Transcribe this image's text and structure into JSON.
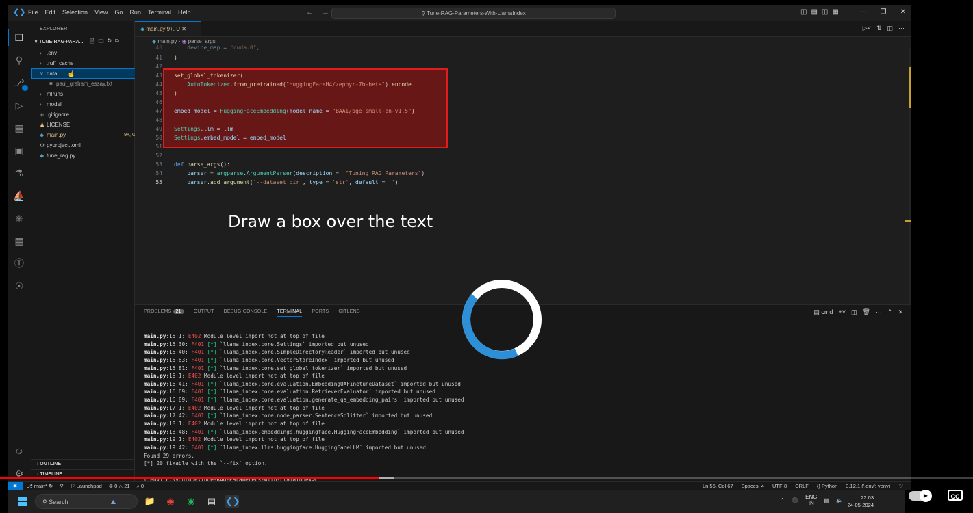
{
  "titlebar": {
    "menu": [
      "File",
      "Edit",
      "Selection",
      "View",
      "Go",
      "Run",
      "Terminal",
      "Help"
    ],
    "search": "Tune-RAG-Parameters-With-LlamaIndex"
  },
  "explorer": {
    "header": "EXPLORER",
    "folder": "TUNE-RAG-PARA...",
    "items": [
      {
        "label": ".env",
        "status": ""
      },
      {
        "label": ".ruff_cache",
        "status": ""
      },
      {
        "label": "data",
        "status": ""
      },
      {
        "label": "paul_graham_essay.txt",
        "status": ""
      },
      {
        "label": "mlruns",
        "status": ""
      },
      {
        "label": "model",
        "status": ""
      },
      {
        "label": ".gitignore",
        "status": ""
      },
      {
        "label": "LICENSE",
        "status": ""
      },
      {
        "label": "main.py",
        "status": "9+, U"
      },
      {
        "label": "pyproject.toml",
        "status": ""
      },
      {
        "label": "tune_rag.py",
        "status": ""
      }
    ],
    "outline": "OUTLINE",
    "timeline": "TIMELINE"
  },
  "tab": {
    "name": "main.py",
    "status": "9+, U"
  },
  "breadcrumb": {
    "file": "main.py",
    "symbol": "parse_args"
  },
  "editor": {
    "line41": "41",
    "line42": "42",
    "line43": "43",
    "line44": "44",
    "line45": "45",
    "line46": "46",
    "line47": "47",
    "line48": "48",
    "line49": "49",
    "line50": "50",
    "line51": "51",
    "line52": "52",
    "line53": "53",
    "line54": "54",
    "line55": "55"
  },
  "overlay": {
    "text": "Draw a box over the text"
  },
  "panel": {
    "tabs": [
      "PROBLEMS",
      "OUTPUT",
      "DEBUG CONSOLE",
      "TERMINAL",
      "PORTS",
      "GITLENS"
    ],
    "problem_count": "21",
    "shell": "cmd",
    "terminal_lines": [
      {
        "file": "main.py",
        "pos": ":15:1: ",
        "code": "E402",
        "fix": "",
        "msg": " Module level import not at top of file"
      },
      {
        "file": "main.py",
        "pos": ":15:30: ",
        "code": "F401",
        "fix": " [*]",
        "msg": " `llama_index.core.Settings` imported but unused"
      },
      {
        "file": "main.py",
        "pos": ":15:40: ",
        "code": "F401",
        "fix": " [*]",
        "msg": " `llama_index.core.SimpleDirectoryReader` imported but unused"
      },
      {
        "file": "main.py",
        "pos": ":15:63: ",
        "code": "F401",
        "fix": " [*]",
        "msg": " `llama_index.core.VectorStoreIndex` imported but unused"
      },
      {
        "file": "main.py",
        "pos": ":15:81: ",
        "code": "F401",
        "fix": " [*]",
        "msg": " `llama_index.core.set_global_tokenizer` imported but unused"
      },
      {
        "file": "main.py",
        "pos": ":16:1: ",
        "code": "E402",
        "fix": "",
        "msg": " Module level import not at top of file"
      },
      {
        "file": "main.py",
        "pos": ":16:41: ",
        "code": "F401",
        "fix": " [*]",
        "msg": " `llama_index.core.evaluation.EmbeddingQAFinetuneDataset` imported but unused"
      },
      {
        "file": "main.py",
        "pos": ":16:69: ",
        "code": "F401",
        "fix": " [*]",
        "msg": " `llama_index.core.evaluation.RetrieverEvaluator` imported but unused"
      },
      {
        "file": "main.py",
        "pos": ":16:89: ",
        "code": "F401",
        "fix": " [*]",
        "msg": " `llama_index.core.evaluation.generate_qa_embedding_pairs` imported but unused"
      },
      {
        "file": "main.py",
        "pos": ":17:1: ",
        "code": "E402",
        "fix": "",
        "msg": " Module level import not at top of file"
      },
      {
        "file": "main.py",
        "pos": ":17:42: ",
        "code": "F401",
        "fix": " [*]",
        "msg": " `llama_index.core.node_parser.SentenceSplitter` imported but unused"
      },
      {
        "file": "main.py",
        "pos": ":18:1: ",
        "code": "E402",
        "fix": "",
        "msg": " Module level import not at top of file"
      },
      {
        "file": "main.py",
        "pos": ":18:48: ",
        "code": "F401",
        "fix": " [*]",
        "msg": " `llama_index.embeddings.huggingface.HuggingFaceEmbedding` imported but unused"
      },
      {
        "file": "main.py",
        "pos": ":19:1: ",
        "code": "E402",
        "fix": "",
        "msg": " Module level import not at top of file"
      },
      {
        "file": "main.py",
        "pos": ":19:42: ",
        "code": "F401",
        "fix": " [*]",
        "msg": " `llama_index.llms.huggingface.HuggingFaceLLM` imported but unused"
      }
    ],
    "summary1": "Found 29 errors.",
    "summary2": "[*] 20 fixable with the `--fix` option.",
    "prompt": "(.env) E:\\youtube\\Tune-RAG-Parameters-With-LlamaIndex>"
  },
  "statusbar": {
    "branch": "main*",
    "launchpad": "Launchpad",
    "errors": "0",
    "warnings": "21",
    "ports": "0",
    "position": "Ln 55, Col 67",
    "spaces": "Spaces: 4",
    "encoding": "UTF-8",
    "eol": "CRLF",
    "language": "Python",
    "interpreter": "3.12.1 ('.env': venv)"
  },
  "taskbar": {
    "search": "Search",
    "lang": "ENG",
    "region": "IN",
    "time": "22:03",
    "date": "24-05-2024"
  },
  "player": {
    "cc": "CC",
    "played_fraction": 0.389
  }
}
